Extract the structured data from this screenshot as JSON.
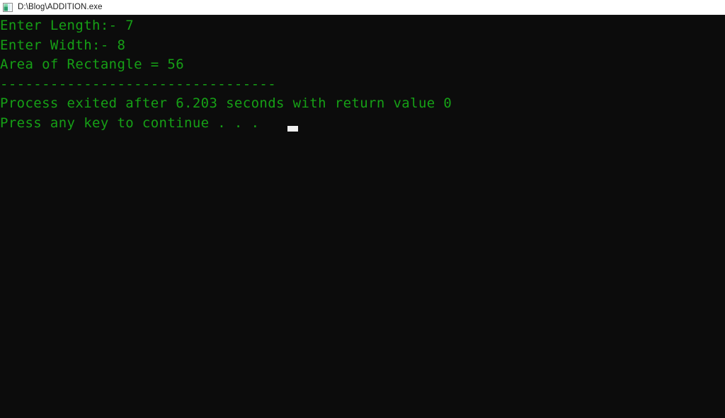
{
  "window": {
    "title": "D:\\Blog\\ADDITION.exe",
    "icon": "console-app-icon",
    "titlebar_bg": "#ffffff",
    "titlebar_text_color": "#1c1c1c"
  },
  "top_strip": {
    "name": "progress-strip",
    "track_color": "#e6e6e6",
    "fill_color": "#0078d4"
  },
  "console": {
    "background": "#0c0c0c",
    "text_color": "#16a016",
    "cursor_color": "#f0f0f0",
    "lines": [
      "Enter Length:- 7",
      "Enter Width:- 8",
      "Area of Rectangle = 56",
      "---------------------------------",
      "Process exited after 6.203 seconds with return value 0",
      "Press any key to continue . . ."
    ],
    "values": {
      "length": "7",
      "width": "8",
      "area": "56",
      "elapsed_seconds": "6.203",
      "return_value": "0"
    }
  }
}
